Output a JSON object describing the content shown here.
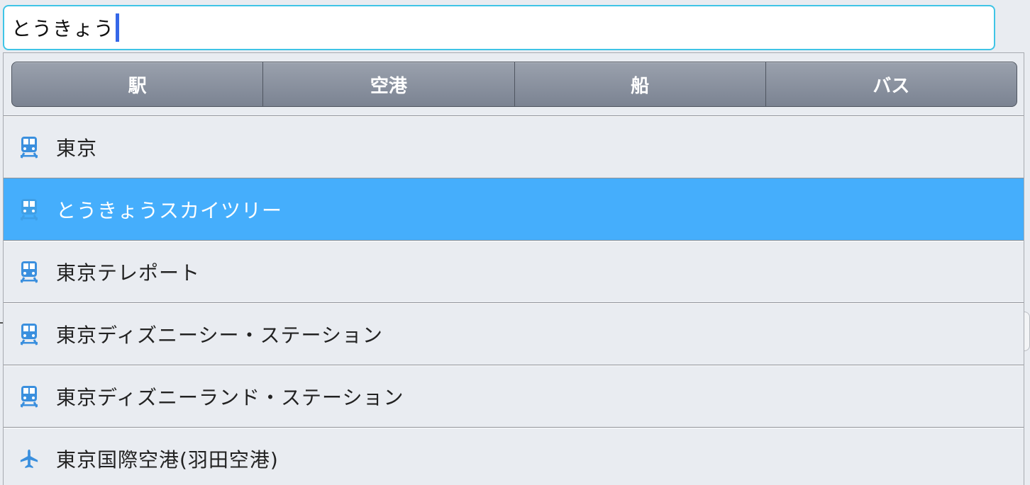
{
  "search": {
    "value": "とうきょう"
  },
  "tabs": [
    {
      "label": "駅"
    },
    {
      "label": "空港"
    },
    {
      "label": "船"
    },
    {
      "label": "バス"
    }
  ],
  "results": [
    {
      "label": "東京",
      "icon": "train-icon",
      "selected": false
    },
    {
      "label": "とうきょうスカイツリー",
      "icon": "train-icon",
      "selected": true
    },
    {
      "label": "東京テレポート",
      "icon": "train-icon",
      "selected": false
    },
    {
      "label": "東京ディズニーシー・ステーション",
      "icon": "train-icon",
      "selected": false
    },
    {
      "label": "東京ディズニーランド・ステーション",
      "icon": "train-icon",
      "selected": false
    },
    {
      "label": "東京国際空港(羽田空港)",
      "icon": "airplane-icon",
      "selected": false
    }
  ],
  "colors": {
    "input_border": "#3fc4e6",
    "caret": "#3567e8",
    "selected_row": "#45aefc",
    "icon": "#3a8fde"
  }
}
